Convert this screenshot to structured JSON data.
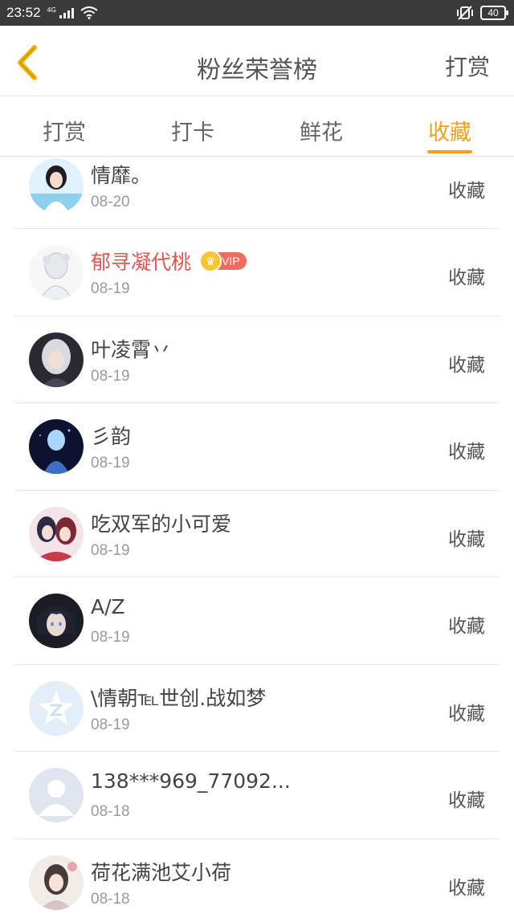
{
  "status_bar": {
    "time": "23:52",
    "network": "4G",
    "battery": "40"
  },
  "header": {
    "title": "粉丝荣誉榜",
    "action": "打赏",
    "back_icon": "chevron-left-icon"
  },
  "tabs": [
    {
      "label": "打赏",
      "active": false
    },
    {
      "label": "打卡",
      "active": false
    },
    {
      "label": "鲜花",
      "active": false
    },
    {
      "label": "收藏",
      "active": true
    }
  ],
  "colors": {
    "accent": "#f6a01a",
    "vip_name": "#e8554e",
    "status_bar": "#3a3a3a"
  },
  "list": [
    {
      "name": "情靡。",
      "date": "08-20",
      "action": "收藏",
      "vip": false,
      "avatar": "avatar-girl-blue"
    },
    {
      "name": "郁寻凝代桃",
      "date": "08-19",
      "action": "收藏",
      "vip": true,
      "vip_label": "VIP",
      "avatar": "avatar-sketch"
    },
    {
      "name": "叶凌霄丷",
      "date": "08-19",
      "action": "收藏",
      "vip": false,
      "avatar": "avatar-white-hair"
    },
    {
      "name": "彡韵",
      "date": "08-19",
      "action": "收藏",
      "vip": false,
      "avatar": "avatar-dark-blue"
    },
    {
      "name": "吃双军的小可爱",
      "date": "08-19",
      "action": "收藏",
      "vip": false,
      "avatar": "avatar-pair"
    },
    {
      "name": "A/Z",
      "date": "08-19",
      "action": "收藏",
      "vip": false,
      "avatar": "avatar-dark-boy"
    },
    {
      "name": "\\情朝℡世创.战如梦",
      "date": "08-19",
      "action": "收藏",
      "vip": false,
      "avatar": "avatar-star-logo"
    },
    {
      "name": "138***969_77092...",
      "date": "08-18",
      "action": "收藏",
      "vip": false,
      "avatar": "avatar-default-user"
    },
    {
      "name": "荷花满池艾小荷",
      "date": "08-18",
      "action": "收藏",
      "vip": false,
      "avatar": "avatar-girl-flowers"
    }
  ]
}
